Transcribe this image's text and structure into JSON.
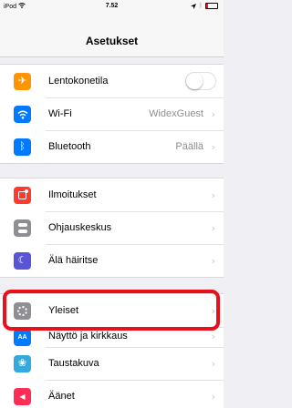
{
  "status_bar": {
    "carrier": "iPod",
    "time": "7.52",
    "battery_level": 0.15
  },
  "nav": {
    "title": "Asetukset"
  },
  "colors": {
    "airplane": "#ff9500",
    "wifi": "#007aff",
    "bluetooth": "#007aff",
    "notifications": "#ff3b30",
    "control_center": "#8e8e93",
    "do_not_disturb": "#5856d6",
    "general": "#8e8e93",
    "display": "#007aff",
    "wallpaper": "#34aadc",
    "sounds": "#ff2d55",
    "highlight": "#e8101a"
  },
  "groups": {
    "connectivity": [
      {
        "label": "Lentokonetila",
        "icon": "airplane-icon",
        "value": "",
        "toggle": true,
        "toggle_on": false
      },
      {
        "label": "Wi-Fi",
        "icon": "wifi-icon",
        "value": "WidexGuest"
      },
      {
        "label": "Bluetooth",
        "icon": "bluetooth-icon",
        "value": "Päällä"
      }
    ],
    "system": [
      {
        "label": "Ilmoitukset",
        "icon": "notifications-icon"
      },
      {
        "label": "Ohjauskeskus",
        "icon": "control-center-icon"
      },
      {
        "label": "Älä häiritse",
        "icon": "moon-icon"
      }
    ],
    "settings": [
      {
        "label": "Yleiset",
        "icon": "gear-icon"
      },
      {
        "label": "Näyttö ja kirkkaus",
        "icon": "display-icon"
      },
      {
        "label": "Taustakuva",
        "icon": "wallpaper-icon"
      },
      {
        "label": "Äänet",
        "icon": "speaker-icon"
      }
    ]
  },
  "glyphs": {
    "chevron": "›",
    "airplane": "✈",
    "bluetooth": "ᛒ",
    "moon": "☾",
    "display_text": "AA",
    "wallpaper": "❀",
    "speaker": "◀"
  }
}
